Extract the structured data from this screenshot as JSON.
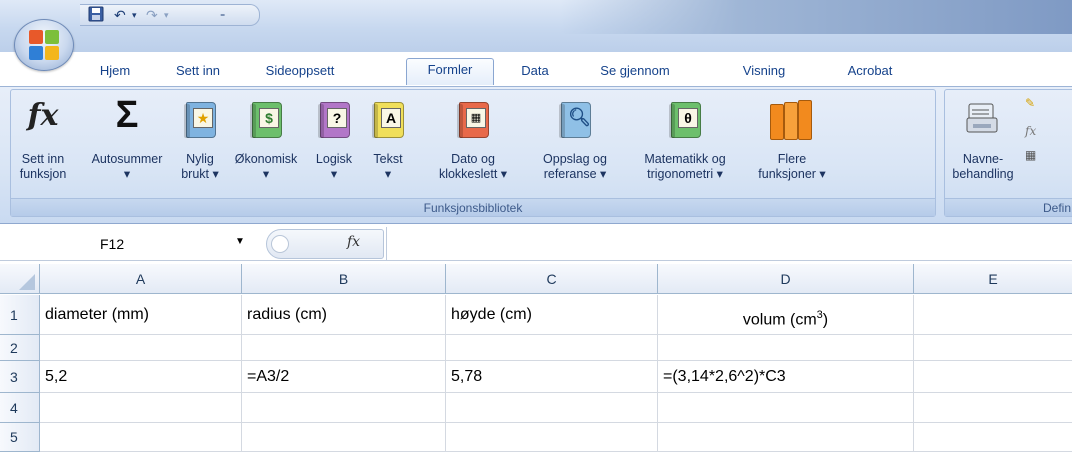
{
  "quick_access": {
    "save_icon": "save-icon",
    "undo_glyph": "↶",
    "redo_glyph": "↷"
  },
  "tabs": [
    {
      "label": "Hjem"
    },
    {
      "label": "Sett inn"
    },
    {
      "label": "Sideoppsett"
    },
    {
      "label": "Formler",
      "active": true
    },
    {
      "label": "Data"
    },
    {
      "label": "Se gjennom"
    },
    {
      "label": "Visning"
    },
    {
      "label": "Acrobat"
    }
  ],
  "ribbon": {
    "groups": [
      {
        "title": "Funksjonsbibliotek"
      },
      {
        "title": "Defin"
      }
    ],
    "buttons": [
      {
        "label": "Sett inn funksjon",
        "icon": "fx-icon"
      },
      {
        "label": "Autosummer",
        "icon": "sigma-icon",
        "dropdown": true
      },
      {
        "label": "Nylig brukt",
        "icon": "star-book-icon",
        "dropdown": true
      },
      {
        "label": "Økonomisk",
        "icon": "money-book-icon",
        "dropdown": true
      },
      {
        "label": "Logisk",
        "icon": "question-book-icon",
        "dropdown": true
      },
      {
        "label": "Tekst",
        "icon": "text-book-icon",
        "dropdown": true
      },
      {
        "label": "Dato og klokkeslett",
        "icon": "calendar-book-icon",
        "dropdown": true
      },
      {
        "label": "Oppslag og referanse",
        "icon": "magnifier-book-icon",
        "dropdown": true
      },
      {
        "label": "Matematikk og trigonometri",
        "icon": "theta-book-icon",
        "dropdown": true
      },
      {
        "label": "Flere funksjoner",
        "icon": "books-icon",
        "dropdown": true
      },
      {
        "label": "Navne- behandling",
        "icon": "name-manager-icon"
      }
    ],
    "lines": {
      "b0": [
        "Sett inn",
        "funksjon"
      ],
      "b1": [
        "Autosummer",
        "▾"
      ],
      "b2": [
        "Nylig",
        "brukt ▾"
      ],
      "b3": [
        "Økonomisk",
        "▾"
      ],
      "b4": [
        "Logisk",
        "▾"
      ],
      "b5": [
        "Tekst",
        "▾"
      ],
      "b6": [
        "Dato og",
        "klokkeslett ▾"
      ],
      "b7": [
        "Oppslag og",
        "referanse ▾"
      ],
      "b8": [
        "Matematikk og",
        "trigonometri ▾"
      ],
      "b9": [
        "Flere",
        "funksjoner ▾"
      ],
      "b10": [
        "Navne-",
        "behandling"
      ]
    }
  },
  "formula_bar": {
    "name_box": "F12",
    "fx": "fx",
    "formula": ""
  },
  "sheet": {
    "columns": [
      "A",
      "B",
      "C",
      "D",
      "E"
    ],
    "rows": [
      "1",
      "2",
      "3",
      "4",
      "5"
    ],
    "cells": {
      "A1": "diameter  (mm)",
      "B1": "radius  (cm)",
      "C1": "høyde (cm)",
      "D1": "volum (cm",
      "D1_sup": "3",
      "D1_end": ")",
      "A3": "5,2",
      "B3": "=A3/2",
      "C3": "5,78",
      "D3": "=(3,14*2,6^2)*C3"
    }
  },
  "colors": {
    "tab_text": "#15428b",
    "ribbon_bg": "#dbe6f5",
    "header_bg": "#e3eaf5"
  }
}
